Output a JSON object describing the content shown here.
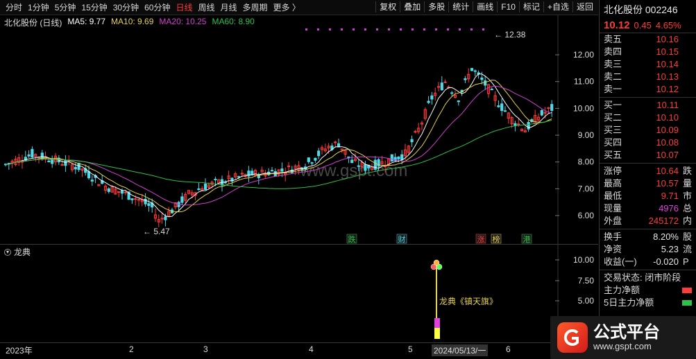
{
  "toolbar": {
    "periods": [
      "分时",
      "1分钟",
      "5分钟",
      "15分钟",
      "30分钟",
      "60分钟",
      "日线",
      "周线",
      "月线",
      "多周期",
      "更多 〉"
    ],
    "active_period": "日线",
    "tools": [
      "复权",
      "叠加",
      "多股",
      "统计",
      "画线",
      "F10",
      "标记",
      "+自选",
      "返回"
    ]
  },
  "legend": {
    "stock": "北化股份 (日线)",
    "ma5": "MA5: 9.77",
    "ma10": "MA10: 9.69",
    "ma20": "MA20: 10.25",
    "ma60": "MA60: 8.90",
    "colors": {
      "ma5": "#ffffff",
      "ma10": "#e8d24a",
      "ma20": "#d040d0",
      "ma60": "#2ec24a",
      "up": "#ff3b3b",
      "down": "#4fd8e8"
    }
  },
  "chart": {
    "high_label": "12.38",
    "low_label": "5.47",
    "watermark": "www.gspt.com",
    "event_tags": [
      "跌",
      "财",
      "涨",
      "榜",
      "港"
    ]
  },
  "subchart": {
    "title": "龙典",
    "annotation": "龙典《镇天旗》",
    "yticks": [
      "10.00",
      "7.50",
      "5.00"
    ]
  },
  "xaxis": {
    "labels": [
      "2023年",
      "2",
      "3",
      "4",
      "5",
      "2024/05/13/一",
      "6"
    ]
  },
  "chart_data": {
    "type": "candlestick",
    "ylim": [
      5.2,
      12.7
    ],
    "yticks": [
      "12.00",
      "11.00",
      "10.00",
      "9.00",
      "8.00",
      "7.00",
      "6.00"
    ],
    "note_series": [
      "MA5",
      "MA10",
      "MA20",
      "MA60"
    ]
  },
  "quote": {
    "name": "北化股份 002246",
    "price": "10.12",
    "change": "0.45",
    "pct": "4.65%",
    "asks": [
      [
        "卖五",
        "10.16"
      ],
      [
        "卖四",
        "10.15"
      ],
      [
        "卖三",
        "10.14"
      ],
      [
        "卖二",
        "10.13"
      ],
      [
        "卖一",
        "10.12"
      ]
    ],
    "bids": [
      [
        "买一",
        "10.11"
      ],
      [
        "买二",
        "10.10"
      ],
      [
        "买三",
        "10.09"
      ],
      [
        "买四",
        "10.08"
      ],
      [
        "买五",
        "10.07"
      ]
    ],
    "stats": [
      [
        "涨停",
        "10.64",
        "跌"
      ],
      [
        "最高",
        "10.57",
        "量"
      ],
      [
        "最低",
        "9.71",
        "市"
      ],
      [
        "现量",
        "4976",
        "总"
      ],
      [
        "外盘",
        "245172",
        "内"
      ]
    ],
    "stats2": [
      [
        "换手",
        "8.20%",
        "股"
      ],
      [
        "净资",
        "5.23",
        "流"
      ],
      [
        "收益(一)",
        "-0.020",
        "P"
      ]
    ],
    "trade_state": "交易状态: 闭市阶段",
    "money1": "主力净额",
    "money2": "5日主力净额"
  },
  "logo": {
    "title": "公式平台",
    "url": "www.gspt.com"
  }
}
